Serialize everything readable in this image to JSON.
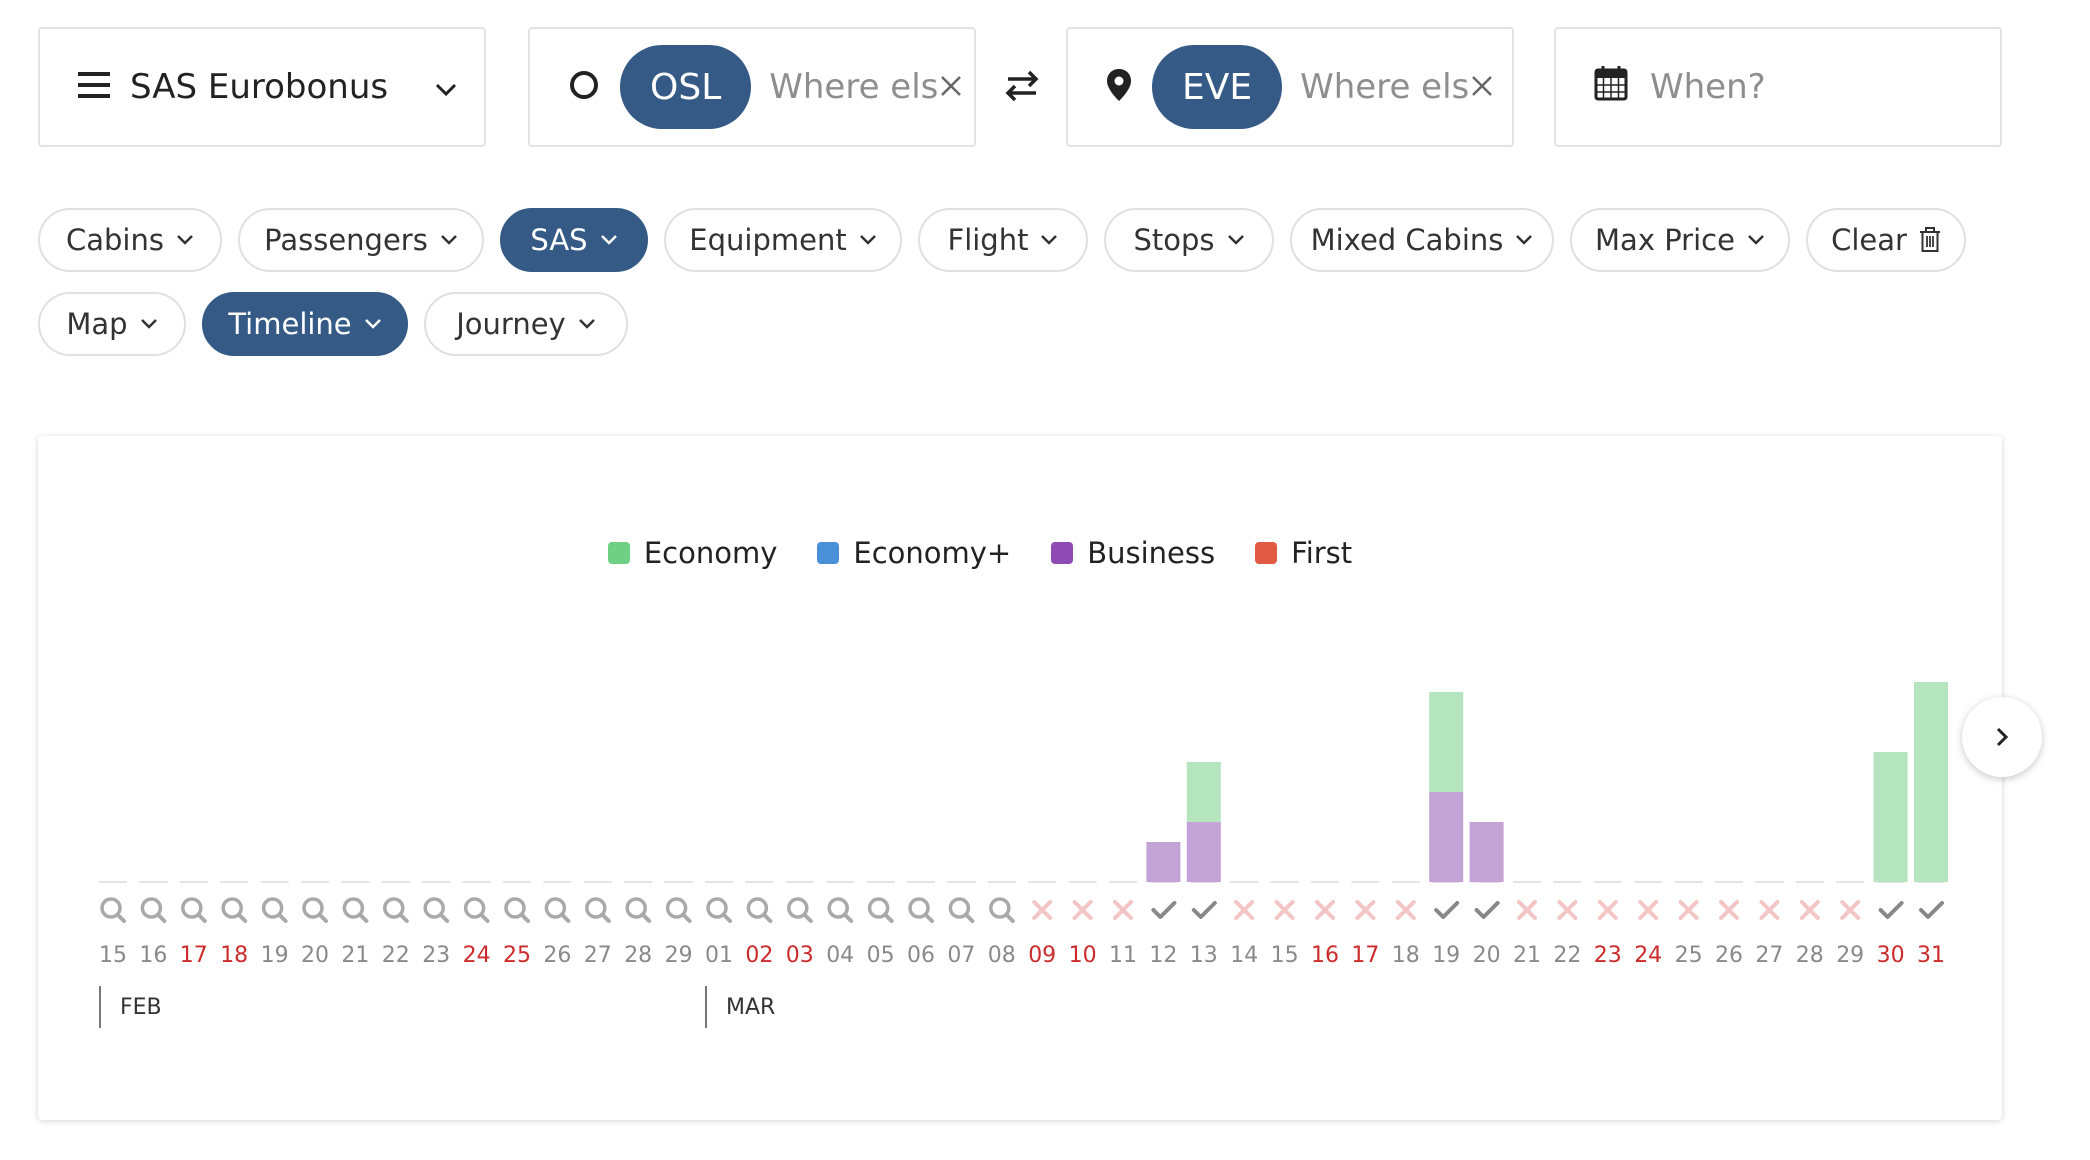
{
  "search": {
    "program": "SAS Eurobonus",
    "origin_code": "OSL",
    "origin_placeholder": "Where else?",
    "dest_code": "EVE",
    "dest_placeholder": "Where else?",
    "when_placeholder": "When?"
  },
  "filters": {
    "row1": [
      "Cabins",
      "Passengers",
      "SAS",
      "Equipment",
      "Flight",
      "Stops",
      "Mixed Cabins",
      "Max Price"
    ],
    "clear": "Clear",
    "row2": [
      "Map",
      "Timeline",
      "Journey"
    ],
    "active": [
      "SAS",
      "Timeline"
    ]
  },
  "legend": [
    {
      "name": "Economy",
      "color": "#6fcf83"
    },
    {
      "name": "Economy+",
      "color": "#4a90d9"
    },
    {
      "name": "Business",
      "color": "#8e4bb4"
    },
    {
      "name": "First",
      "color": "#e05a44"
    }
  ],
  "colors": {
    "accent": "#355a86",
    "weekend_red": "#cc2b2b",
    "economy_fill": "#b4e5be",
    "business_fill": "#c4a3d7",
    "cross": "#f3c5c5",
    "check": "#888888",
    "search_icon": "#a9a9a9"
  },
  "chart_data": {
    "type": "bar",
    "stacked": true,
    "months": [
      {
        "label": "FEB",
        "start_index": 0
      },
      {
        "label": "MAR",
        "start_index": 15
      }
    ],
    "days": [
      {
        "label": "15",
        "status": "unsearched",
        "weekend": false
      },
      {
        "label": "16",
        "status": "unsearched",
        "weekend": false
      },
      {
        "label": "17",
        "status": "unsearched",
        "weekend": true
      },
      {
        "label": "18",
        "status": "unsearched",
        "weekend": true
      },
      {
        "label": "19",
        "status": "unsearched",
        "weekend": false
      },
      {
        "label": "20",
        "status": "unsearched",
        "weekend": false
      },
      {
        "label": "21",
        "status": "unsearched",
        "weekend": false
      },
      {
        "label": "22",
        "status": "unsearched",
        "weekend": false
      },
      {
        "label": "23",
        "status": "unsearched",
        "weekend": false
      },
      {
        "label": "24",
        "status": "unsearched",
        "weekend": true
      },
      {
        "label": "25",
        "status": "unsearched",
        "weekend": true
      },
      {
        "label": "26",
        "status": "unsearched",
        "weekend": false
      },
      {
        "label": "27",
        "status": "unsearched",
        "weekend": false
      },
      {
        "label": "28",
        "status": "unsearched",
        "weekend": false
      },
      {
        "label": "29",
        "status": "unsearched",
        "weekend": false
      },
      {
        "label": "01",
        "status": "unsearched",
        "weekend": false
      },
      {
        "label": "02",
        "status": "unsearched",
        "weekend": true
      },
      {
        "label": "03",
        "status": "unsearched",
        "weekend": true
      },
      {
        "label": "04",
        "status": "unsearched",
        "weekend": false
      },
      {
        "label": "05",
        "status": "unsearched",
        "weekend": false
      },
      {
        "label": "06",
        "status": "unsearched",
        "weekend": false
      },
      {
        "label": "07",
        "status": "unsearched",
        "weekend": false
      },
      {
        "label": "08",
        "status": "unsearched",
        "weekend": false
      },
      {
        "label": "09",
        "status": "none",
        "weekend": true
      },
      {
        "label": "10",
        "status": "none",
        "weekend": true
      },
      {
        "label": "11",
        "status": "none",
        "weekend": false
      },
      {
        "label": "12",
        "status": "available",
        "weekend": false
      },
      {
        "label": "13",
        "status": "available",
        "weekend": false
      },
      {
        "label": "14",
        "status": "none",
        "weekend": false
      },
      {
        "label": "15",
        "status": "none",
        "weekend": false
      },
      {
        "label": "16",
        "status": "none",
        "weekend": true
      },
      {
        "label": "17",
        "status": "none",
        "weekend": true
      },
      {
        "label": "18",
        "status": "none",
        "weekend": false
      },
      {
        "label": "19",
        "status": "available",
        "weekend": false
      },
      {
        "label": "20",
        "status": "available",
        "weekend": false
      },
      {
        "label": "21",
        "status": "none",
        "weekend": false
      },
      {
        "label": "22",
        "status": "none",
        "weekend": false
      },
      {
        "label": "23",
        "status": "none",
        "weekend": true
      },
      {
        "label": "24",
        "status": "none",
        "weekend": true
      },
      {
        "label": "25",
        "status": "none",
        "weekend": false
      },
      {
        "label": "26",
        "status": "none",
        "weekend": false
      },
      {
        "label": "27",
        "status": "none",
        "weekend": false
      },
      {
        "label": "28",
        "status": "none",
        "weekend": false
      },
      {
        "label": "29",
        "status": "none",
        "weekend": false
      },
      {
        "label": "30",
        "status": "available",
        "weekend": true
      },
      {
        "label": "31",
        "status": "available",
        "weekend": true
      }
    ],
    "series": [
      {
        "name": "Economy",
        "values": [
          0,
          0,
          0,
          0,
          0,
          0,
          0,
          0,
          0,
          0,
          0,
          0,
          0,
          0,
          0,
          0,
          0,
          0,
          0,
          0,
          0,
          0,
          0,
          0,
          0,
          0,
          0,
          1.5,
          0,
          0,
          0,
          0,
          0,
          2.5,
          0,
          0,
          0,
          0,
          0,
          0,
          0,
          0,
          0,
          0,
          3.25,
          5.0
        ]
      },
      {
        "name": "Business",
        "values": [
          0,
          0,
          0,
          0,
          0,
          0,
          0,
          0,
          0,
          0,
          0,
          0,
          0,
          0,
          0,
          0,
          0,
          0,
          0,
          0,
          0,
          0,
          0,
          0,
          0,
          0,
          1.0,
          1.5,
          0,
          0,
          0,
          0,
          0,
          2.25,
          1.5,
          0,
          0,
          0,
          0,
          0,
          0,
          0,
          0,
          0,
          0,
          0
        ]
      }
    ]
  }
}
